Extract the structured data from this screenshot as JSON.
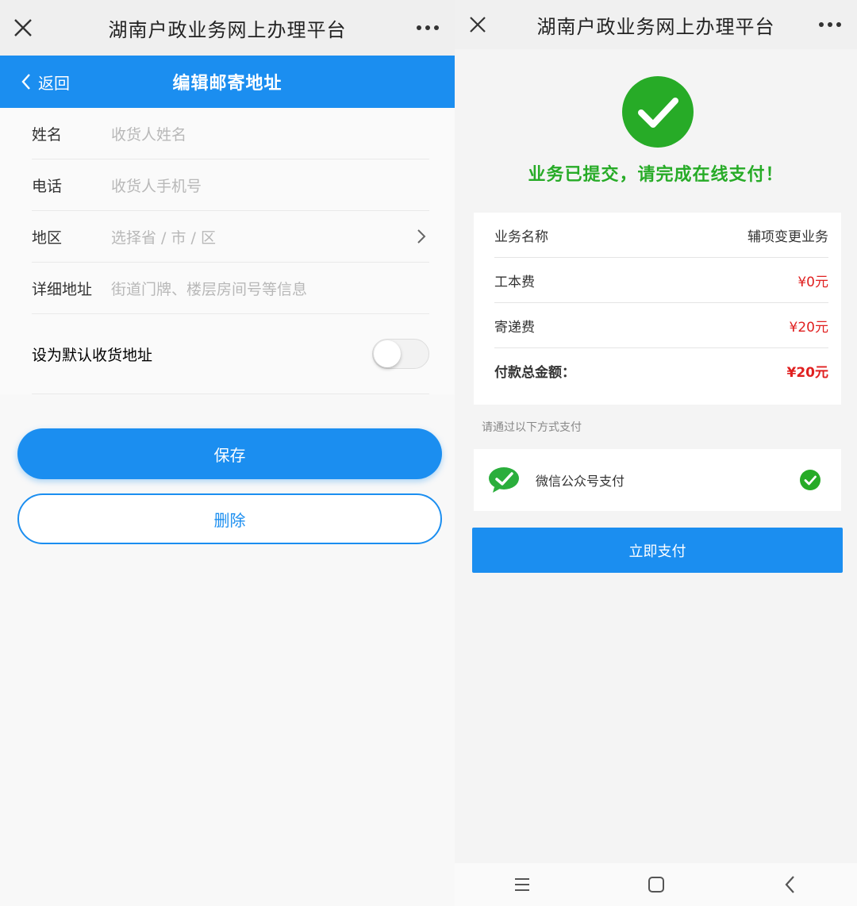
{
  "left": {
    "title": "湖南户政业务网上办理平台",
    "back_label": "返回",
    "page_title": "编辑邮寄地址",
    "fields": [
      {
        "label": "姓名",
        "placeholder": "收货人姓名"
      },
      {
        "label": "电话",
        "placeholder": "收货人手机号"
      },
      {
        "label": "地区",
        "placeholder": "选择省 / 市 / 区"
      },
      {
        "label": "详细地址",
        "placeholder": "街道门牌、楼层房间号等信息"
      }
    ],
    "default_label": "设为默认收货地址",
    "default_on": false,
    "save_label": "保存",
    "delete_label": "删除"
  },
  "right": {
    "title": "湖南户政业务网上办理平台",
    "success_message": "业务已提交，请完成在线支付！",
    "rows": [
      {
        "label": "业务名称",
        "value": "辅项变更业务"
      },
      {
        "label": "工本费",
        "value": "¥0元"
      },
      {
        "label": "寄递费",
        "value": "¥20元"
      },
      {
        "label": "付款总金额：",
        "value": "¥20元"
      }
    ],
    "pay_prompt": "请通过以下方式支付",
    "pay_method": "微信公众号支付",
    "pay_button": "立即支付"
  },
  "colors": {
    "primary": "#1b8ef0",
    "success": "#27ab27",
    "price": "#e02020",
    "wechat": "#2aae3c"
  },
  "icons": [
    "close-icon",
    "more-icon",
    "chevron-left-icon",
    "chevron-right-icon",
    "check-circle-icon",
    "wechat-icon",
    "menu-icon",
    "home-icon",
    "back-icon"
  ]
}
